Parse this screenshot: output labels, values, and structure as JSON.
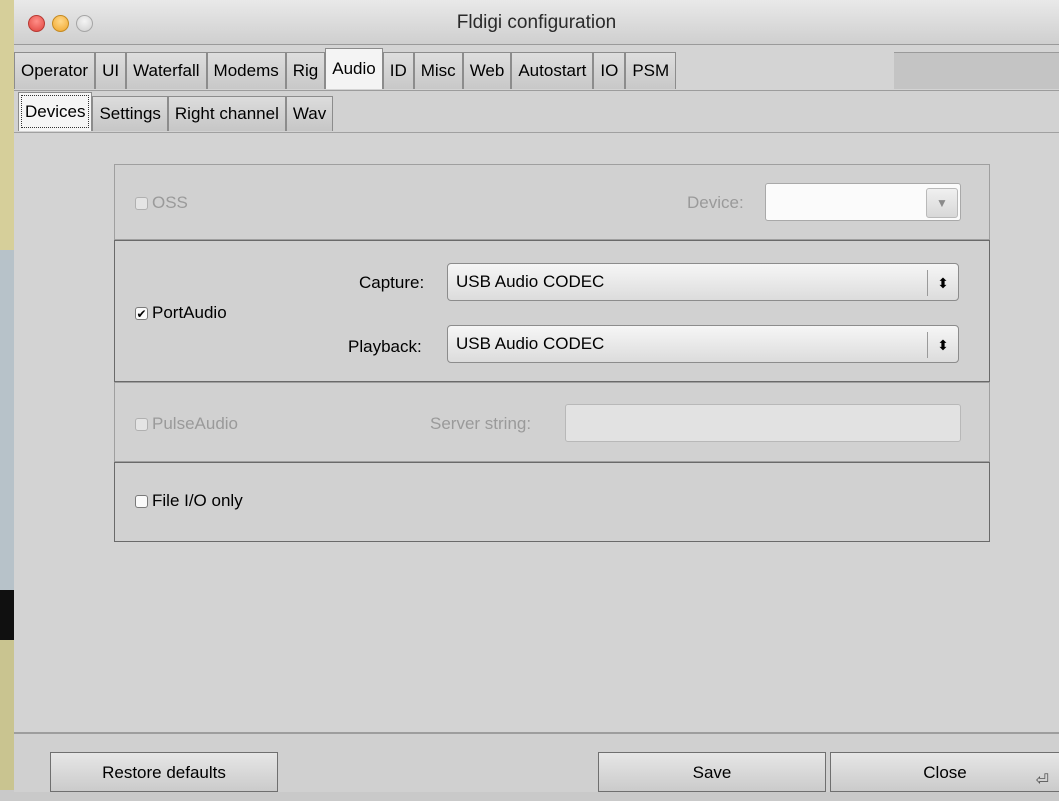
{
  "window": {
    "title": "Fldigi configuration"
  },
  "tabs": [
    "Operator",
    "UI",
    "Waterfall",
    "Modems",
    "Rig",
    "Audio",
    "ID",
    "Misc",
    "Web",
    "Autostart",
    "IO",
    "PSM"
  ],
  "active_tab": "Audio",
  "subtabs": [
    "Devices",
    "Settings",
    "Right channel",
    "Wav"
  ],
  "active_subtab": "Devices",
  "devices": {
    "oss": {
      "label": "OSS",
      "checked": false,
      "device_label": "Device:",
      "device_value": ""
    },
    "portaudio": {
      "label": "PortAudio",
      "checked": true,
      "capture_label": "Capture:",
      "capture_value": "USB Audio CODEC",
      "playback_label": "Playback:",
      "playback_value": "USB Audio CODEC"
    },
    "pulseaudio": {
      "label": "PulseAudio",
      "checked": false,
      "server_label": "Server string:",
      "server_value": ""
    },
    "fileio": {
      "label": "File I/O only",
      "checked": false
    }
  },
  "buttons": {
    "restore": "Restore defaults",
    "save": "Save",
    "close": "Close"
  },
  "icons": {
    "checkmark": "✔",
    "updown": "⬍",
    "dropdown": "▼",
    "enter": "⏎"
  }
}
